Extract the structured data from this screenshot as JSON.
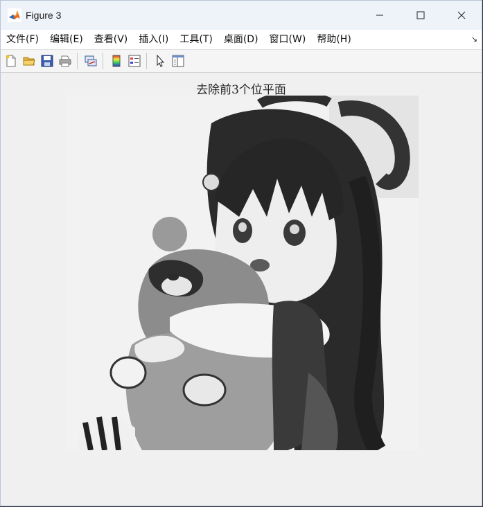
{
  "window": {
    "title": "Figure 3"
  },
  "menubar": {
    "items": [
      {
        "label": "文件(F)"
      },
      {
        "label": "编辑(E)"
      },
      {
        "label": "查看(V)"
      },
      {
        "label": "插入(I)"
      },
      {
        "label": "工具(T)"
      },
      {
        "label": "桌面(D)"
      },
      {
        "label": "窗口(W)"
      },
      {
        "label": "帮助(H)"
      }
    ]
  },
  "toolbar": {
    "buttons": [
      {
        "icon": "new-figure-icon"
      },
      {
        "icon": "open-folder-icon"
      },
      {
        "icon": "save-icon"
      },
      {
        "icon": "print-icon"
      },
      {
        "icon": "link-plot-icon"
      },
      {
        "icon": "colorbar-icon"
      },
      {
        "icon": "legend-icon"
      },
      {
        "icon": "edit-pointer-icon"
      },
      {
        "icon": "property-inspector-icon"
      }
    ]
  },
  "figure": {
    "axes_title": "去除前3个位平面",
    "image_description": "grayscale"
  },
  "colors": {
    "titlebar_bg": "#eef2f9",
    "figure_bg": "#f0f0f0",
    "image_bg": "#f2f2f2"
  }
}
